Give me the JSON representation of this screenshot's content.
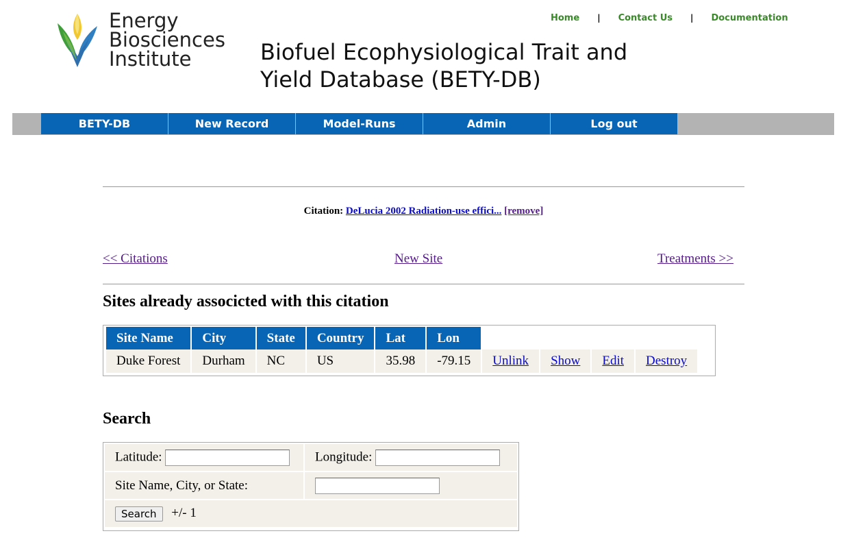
{
  "header": {
    "logo_text": [
      "Energy",
      "Biosciences",
      "Institute"
    ],
    "title_lines": [
      "Biofuel Ecophysiological Trait and",
      "Yield Database (BETY-DB)"
    ],
    "toplinks": [
      "Home",
      "Contact Us",
      "Documentation"
    ],
    "separator": "|"
  },
  "nav": {
    "items": [
      "BETY-DB",
      "New Record",
      "Model-Runs",
      "Admin",
      "Log out"
    ]
  },
  "citation": {
    "label": "Citation:",
    "link_text": "DeLucia 2002 Radiation-use effici...",
    "remove_text": "[remove]"
  },
  "links": {
    "prev": "<< Citations",
    "new": "New Site",
    "next": "Treatments >>"
  },
  "sites": {
    "heading": "Sites already associcted with this citation",
    "columns": [
      "Site Name",
      "City",
      "State",
      "Country",
      "Lat",
      "Lon"
    ],
    "rows": [
      {
        "site_name": "Duke Forest",
        "city": "Durham",
        "state": "NC",
        "country": "US",
        "lat": "35.98",
        "lon": "-79.15",
        "actions": [
          "Unlink",
          "Show",
          "Edit",
          "Destroy"
        ]
      }
    ]
  },
  "search": {
    "heading": "Search",
    "latitude_label": "Latitude:",
    "longitude_label": "Longitude:",
    "name_label": "Site Name, City, or State:",
    "latitude_value": "",
    "longitude_value": "",
    "name_value": "",
    "button_label": "Search",
    "tolerance": "+/- 1"
  },
  "colors": {
    "nav_blue": "#0865b5",
    "nav_gray": "#b3b3b3",
    "toplink_green": "#3a8a2a",
    "cell_bg": "#f2f0e8"
  }
}
